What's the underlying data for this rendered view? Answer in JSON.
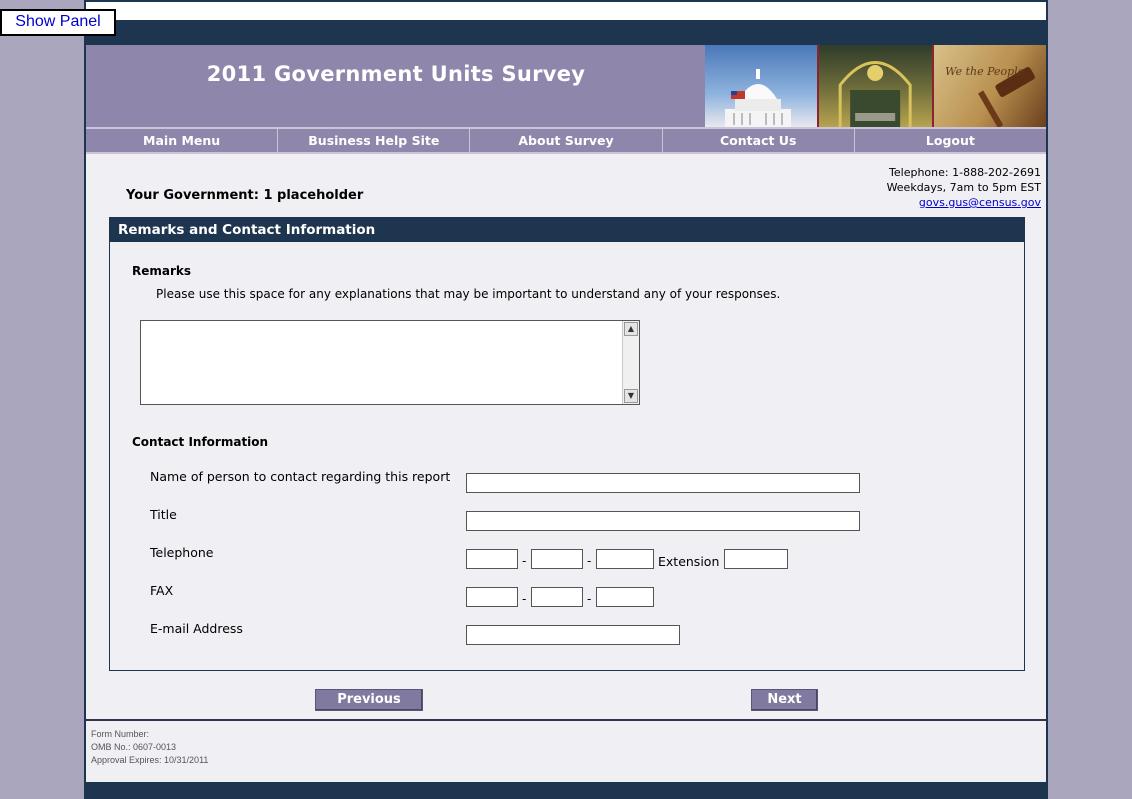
{
  "show_panel_label": "Show Panel",
  "banner": {
    "title": "2011 Government Units Survey"
  },
  "nav": [
    {
      "label": "Main Menu"
    },
    {
      "label": "Business Help Site"
    },
    {
      "label": "About Survey"
    },
    {
      "label": "Contact Us"
    },
    {
      "label": "Logout"
    }
  ],
  "help": {
    "telephone": "Telephone: 1-888-202-2691",
    "hours": "Weekdays, 7am to 5pm EST",
    "email": "govs.gus@census.gov"
  },
  "government_label": "Your Government: 1 placeholder",
  "section": {
    "title": "Remarks and Contact Information",
    "remarks_heading": "Remarks",
    "remarks_note": "Please use this space for any explanations that may be important to understand any of your responses.",
    "remarks_value": "",
    "contact_heading": "Contact Information",
    "fields": {
      "name_label": "Name of person to contact regarding this report",
      "title_label": "Title",
      "telephone_label": "Telephone",
      "extension_label": "Extension",
      "fax_label": "FAX",
      "email_label": "E-mail Address"
    }
  },
  "buttons": {
    "previous": "Previous",
    "next": "Next"
  },
  "footer": {
    "form_number": "Form Number:",
    "omb": "OMB No.: 0607-0013",
    "approval": "Approval Expires: 10/31/2011"
  }
}
